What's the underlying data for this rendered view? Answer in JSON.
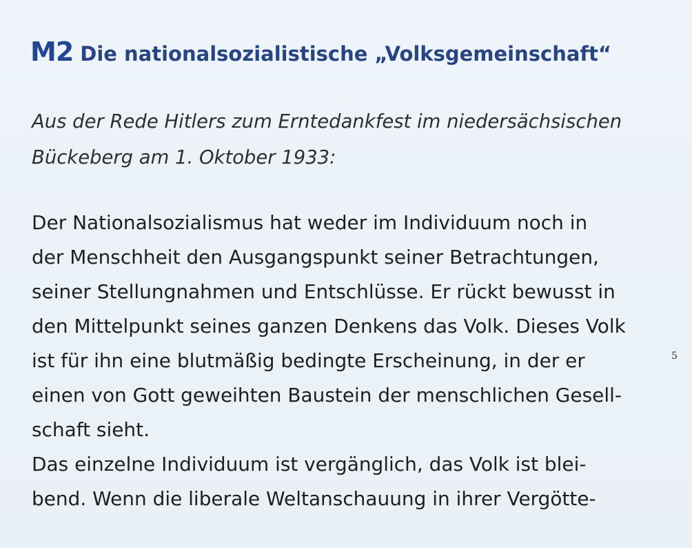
{
  "heading": {
    "label": "M2",
    "title": "Die nationalsozialistische „Volksgemeinschaft“"
  },
  "intro": {
    "lines": [
      "Aus der Rede Hitlers zum Erntedankfest im niedersächsischen",
      "Bückeberg am 1. Oktober 1933:"
    ]
  },
  "body": {
    "lines": [
      "Der Nationalsozialismus hat weder im Individuum noch in",
      "der Menschheit den Ausgangspunkt seiner Betrachtungen,",
      "seiner Stellungnahmen und Entschlüsse. Er rückt bewusst in",
      "den Mittelpunkt seines ganzen Denkens das Volk. Dieses Volk",
      "ist für ihn eine blutmäßig bedingte Erscheinung, in der er",
      "einen von Gott geweihten Baustein der menschlichen Gesell-",
      "schaft sieht.",
      "Das einzelne Individuum ist vergänglich, das Volk ist blei-",
      "bend. Wenn die liberale Weltanschauung in ihrer Vergötte-"
    ]
  },
  "margin": {
    "line_number": "5"
  }
}
